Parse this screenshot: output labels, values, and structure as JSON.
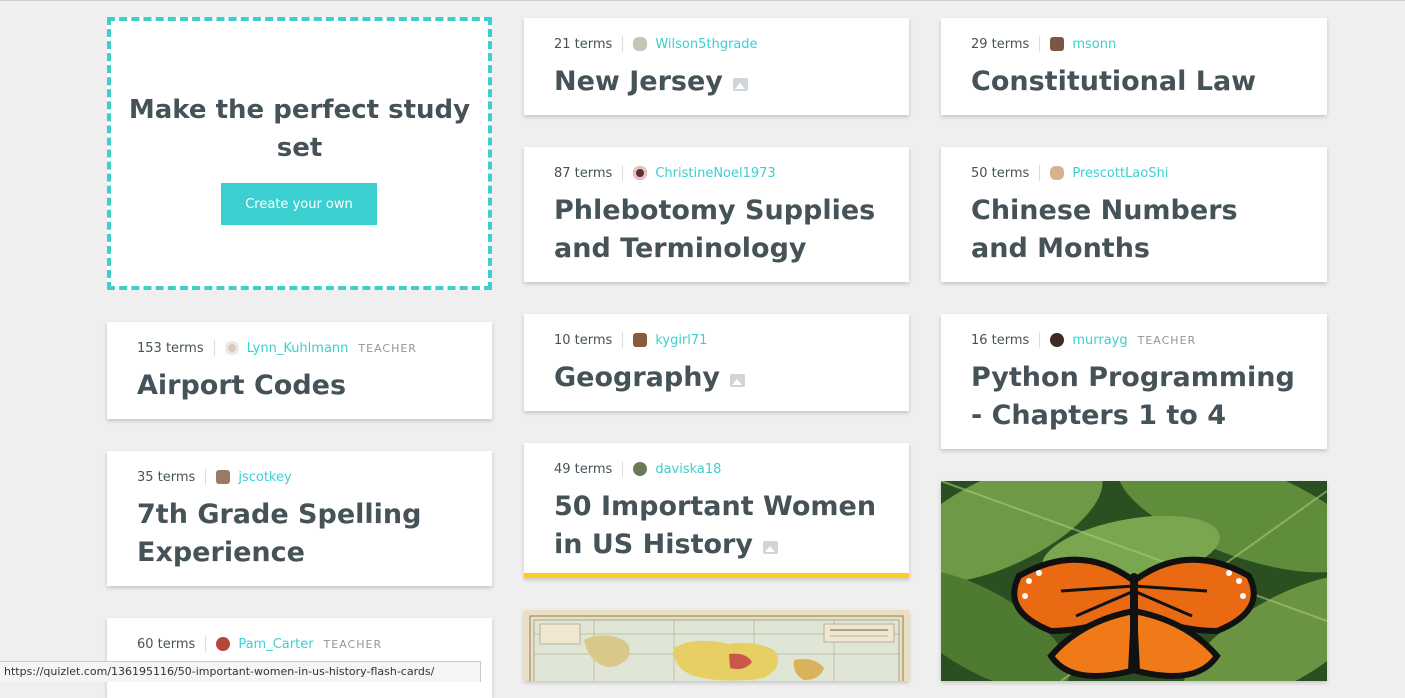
{
  "promo": {
    "title": "Make the perfect study set",
    "button_label": "Create your own"
  },
  "sets": {
    "new_jersey": {
      "terms": "21 terms",
      "user": "Wilson5thgrade",
      "title": "New Jersey"
    },
    "constitutional_law": {
      "terms": "29 terms",
      "user": "msonn",
      "title": "Constitutional Law"
    },
    "phlebotomy": {
      "terms": "87 terms",
      "user": "ChristineNoel1973",
      "title": "Phlebotomy Supplies and Terminology"
    },
    "chinese_numbers": {
      "terms": "50 terms",
      "user": "PrescottLaoShi",
      "title": "Chinese Numbers and Months"
    },
    "airport_codes": {
      "terms": "153 terms",
      "user": "Lynn_Kuhlmann",
      "badge": "TEACHER",
      "title": "Airport Codes"
    },
    "geography": {
      "terms": "10 terms",
      "user": "kygirl71",
      "title": "Geography"
    },
    "python": {
      "terms": "16 terms",
      "user": "murrayg",
      "badge": "TEACHER",
      "title": "Python Programming - Chapters 1 to 4"
    },
    "spelling": {
      "terms": "35 terms",
      "user": "jscotkey",
      "title": "7th Grade Spelling Experience"
    },
    "women_history": {
      "terms": "49 terms",
      "user": "daviska18",
      "title": "50 Important Women in US History"
    },
    "pam_carter": {
      "terms": "60 terms",
      "user": "Pam_Carter",
      "badge": "TEACHER"
    }
  },
  "images": {
    "map_card": "old world map",
    "butterfly_card": "monarch butterfly on leaves"
  },
  "status_url": "https://quizlet.com/136195116/50-important-women-in-us-history-flash-cards/",
  "colors": {
    "accent": "#3ccfcf",
    "text": "#455358",
    "highlight": "#ffcd1f",
    "background": "#efefef"
  }
}
